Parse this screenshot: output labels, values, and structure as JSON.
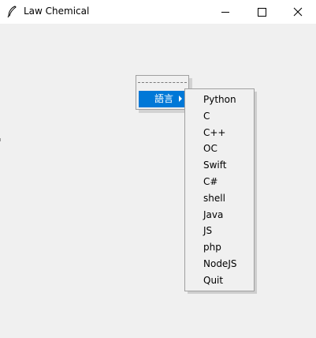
{
  "window": {
    "title": "Law Chemical",
    "app_icon": "feather-icon",
    "controls": {
      "minimize": "minimize-icon",
      "maximize": "maximize-icon",
      "close": "close-icon"
    }
  },
  "menu": {
    "tearoff": "- - - - - - -",
    "item_label": "語言",
    "submenu_indicator": "submenu-arrow-icon",
    "highlight_color": "#0078d7"
  },
  "submenu": {
    "items": [
      "Python",
      "C",
      "C++",
      "OC",
      "Swift",
      "C#",
      "shell",
      "Java",
      "JS",
      "php",
      "NodeJS",
      "Quit"
    ]
  }
}
